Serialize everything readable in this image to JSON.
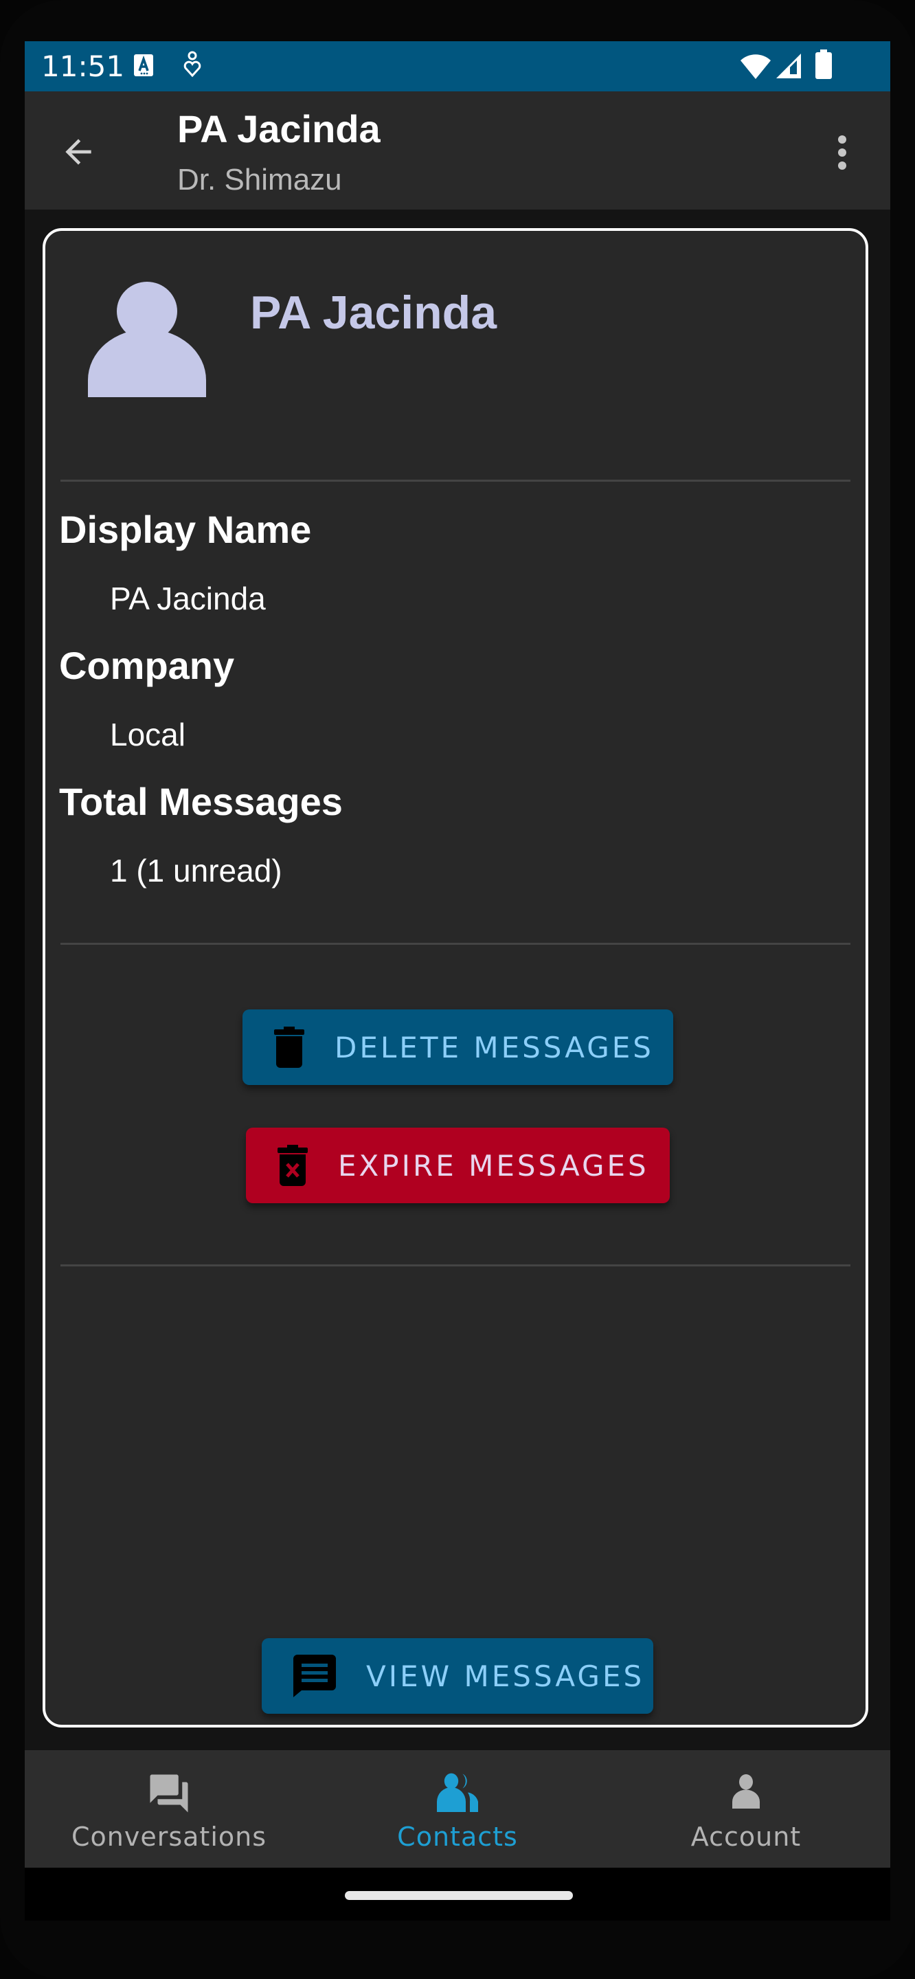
{
  "status_bar": {
    "time": "11:51",
    "left_icons": [
      "accessibility-a-icon",
      "heart-person-icon"
    ],
    "right_icons": [
      "wifi-icon",
      "signal-icon",
      "battery-icon"
    ]
  },
  "app_bar": {
    "title": "PA Jacinda",
    "subtitle": "Dr. Shimazu",
    "back_icon": "arrow-back-icon",
    "menu_icon": "more-vert-icon"
  },
  "contact_card": {
    "name": "PA Jacinda",
    "avatar_icon": "person-icon",
    "fields": [
      {
        "label": "Display Name",
        "value": "PA Jacinda"
      },
      {
        "label": "Company",
        "value": "Local"
      },
      {
        "label": "Total Messages",
        "value": "1 (1 unread)"
      }
    ],
    "actions": {
      "delete_label": "DELETE MESSAGES",
      "expire_label": "EXPIRE MESSAGES",
      "view_label": "VIEW MESSAGES"
    }
  },
  "bottom_nav": {
    "items": [
      {
        "label": "Conversations",
        "icon": "forum-icon",
        "active": false
      },
      {
        "label": "Contacts",
        "icon": "people-icon",
        "active": true
      },
      {
        "label": "Account",
        "icon": "person-icon",
        "active": false
      }
    ]
  },
  "colors": {
    "status_bar": "#01567f",
    "primary_button": "#02557d",
    "danger_button": "#b00020",
    "primary_text_on_button": "#8ccff9",
    "danger_text_on_button": "#e8d6ee",
    "active_nav": "#1e9fd3",
    "inactive_nav": "#b3b3b3",
    "avatar": "#c5c8e8"
  }
}
